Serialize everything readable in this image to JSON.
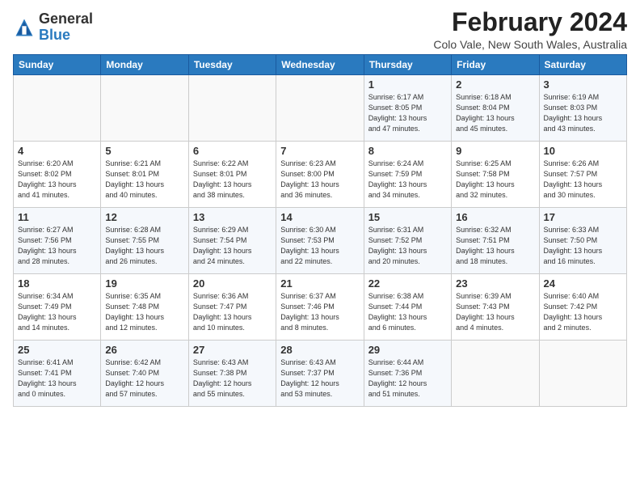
{
  "header": {
    "logo_general": "General",
    "logo_blue": "Blue",
    "title": "February 2024",
    "location": "Colo Vale, New South Wales, Australia"
  },
  "weekdays": [
    "Sunday",
    "Monday",
    "Tuesday",
    "Wednesday",
    "Thursday",
    "Friday",
    "Saturday"
  ],
  "weeks": [
    [
      {
        "day": "",
        "text": ""
      },
      {
        "day": "",
        "text": ""
      },
      {
        "day": "",
        "text": ""
      },
      {
        "day": "",
        "text": ""
      },
      {
        "day": "1",
        "text": "Sunrise: 6:17 AM\nSunset: 8:05 PM\nDaylight: 13 hours\nand 47 minutes."
      },
      {
        "day": "2",
        "text": "Sunrise: 6:18 AM\nSunset: 8:04 PM\nDaylight: 13 hours\nand 45 minutes."
      },
      {
        "day": "3",
        "text": "Sunrise: 6:19 AM\nSunset: 8:03 PM\nDaylight: 13 hours\nand 43 minutes."
      }
    ],
    [
      {
        "day": "4",
        "text": "Sunrise: 6:20 AM\nSunset: 8:02 PM\nDaylight: 13 hours\nand 41 minutes."
      },
      {
        "day": "5",
        "text": "Sunrise: 6:21 AM\nSunset: 8:01 PM\nDaylight: 13 hours\nand 40 minutes."
      },
      {
        "day": "6",
        "text": "Sunrise: 6:22 AM\nSunset: 8:01 PM\nDaylight: 13 hours\nand 38 minutes."
      },
      {
        "day": "7",
        "text": "Sunrise: 6:23 AM\nSunset: 8:00 PM\nDaylight: 13 hours\nand 36 minutes."
      },
      {
        "day": "8",
        "text": "Sunrise: 6:24 AM\nSunset: 7:59 PM\nDaylight: 13 hours\nand 34 minutes."
      },
      {
        "day": "9",
        "text": "Sunrise: 6:25 AM\nSunset: 7:58 PM\nDaylight: 13 hours\nand 32 minutes."
      },
      {
        "day": "10",
        "text": "Sunrise: 6:26 AM\nSunset: 7:57 PM\nDaylight: 13 hours\nand 30 minutes."
      }
    ],
    [
      {
        "day": "11",
        "text": "Sunrise: 6:27 AM\nSunset: 7:56 PM\nDaylight: 13 hours\nand 28 minutes."
      },
      {
        "day": "12",
        "text": "Sunrise: 6:28 AM\nSunset: 7:55 PM\nDaylight: 13 hours\nand 26 minutes."
      },
      {
        "day": "13",
        "text": "Sunrise: 6:29 AM\nSunset: 7:54 PM\nDaylight: 13 hours\nand 24 minutes."
      },
      {
        "day": "14",
        "text": "Sunrise: 6:30 AM\nSunset: 7:53 PM\nDaylight: 13 hours\nand 22 minutes."
      },
      {
        "day": "15",
        "text": "Sunrise: 6:31 AM\nSunset: 7:52 PM\nDaylight: 13 hours\nand 20 minutes."
      },
      {
        "day": "16",
        "text": "Sunrise: 6:32 AM\nSunset: 7:51 PM\nDaylight: 13 hours\nand 18 minutes."
      },
      {
        "day": "17",
        "text": "Sunrise: 6:33 AM\nSunset: 7:50 PM\nDaylight: 13 hours\nand 16 minutes."
      }
    ],
    [
      {
        "day": "18",
        "text": "Sunrise: 6:34 AM\nSunset: 7:49 PM\nDaylight: 13 hours\nand 14 minutes."
      },
      {
        "day": "19",
        "text": "Sunrise: 6:35 AM\nSunset: 7:48 PM\nDaylight: 13 hours\nand 12 minutes."
      },
      {
        "day": "20",
        "text": "Sunrise: 6:36 AM\nSunset: 7:47 PM\nDaylight: 13 hours\nand 10 minutes."
      },
      {
        "day": "21",
        "text": "Sunrise: 6:37 AM\nSunset: 7:46 PM\nDaylight: 13 hours\nand 8 minutes."
      },
      {
        "day": "22",
        "text": "Sunrise: 6:38 AM\nSunset: 7:44 PM\nDaylight: 13 hours\nand 6 minutes."
      },
      {
        "day": "23",
        "text": "Sunrise: 6:39 AM\nSunset: 7:43 PM\nDaylight: 13 hours\nand 4 minutes."
      },
      {
        "day": "24",
        "text": "Sunrise: 6:40 AM\nSunset: 7:42 PM\nDaylight: 13 hours\nand 2 minutes."
      }
    ],
    [
      {
        "day": "25",
        "text": "Sunrise: 6:41 AM\nSunset: 7:41 PM\nDaylight: 13 hours\nand 0 minutes."
      },
      {
        "day": "26",
        "text": "Sunrise: 6:42 AM\nSunset: 7:40 PM\nDaylight: 12 hours\nand 57 minutes."
      },
      {
        "day": "27",
        "text": "Sunrise: 6:43 AM\nSunset: 7:38 PM\nDaylight: 12 hours\nand 55 minutes."
      },
      {
        "day": "28",
        "text": "Sunrise: 6:43 AM\nSunset: 7:37 PM\nDaylight: 12 hours\nand 53 minutes."
      },
      {
        "day": "29",
        "text": "Sunrise: 6:44 AM\nSunset: 7:36 PM\nDaylight: 12 hours\nand 51 minutes."
      },
      {
        "day": "",
        "text": ""
      },
      {
        "day": "",
        "text": ""
      }
    ]
  ]
}
